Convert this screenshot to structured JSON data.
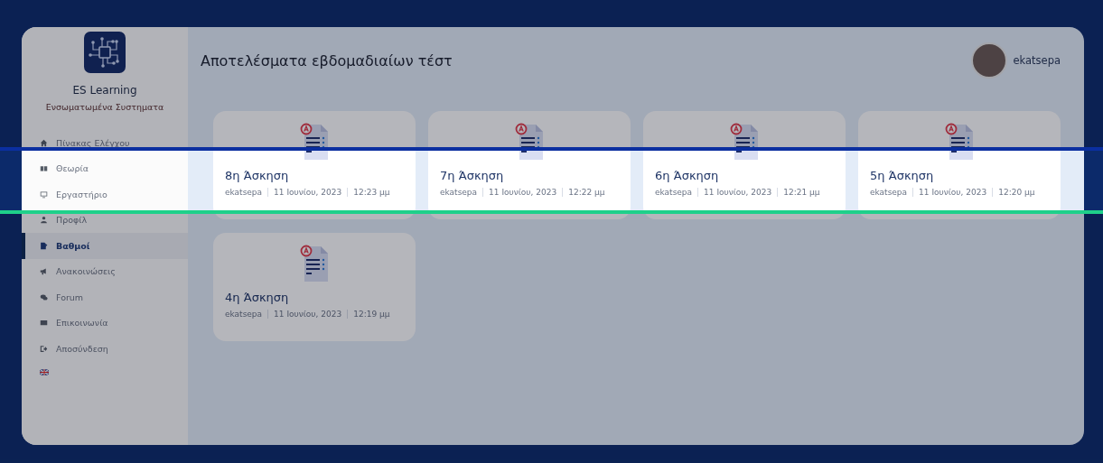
{
  "sidebar": {
    "brand": "ES Learning",
    "subtitle": "Ενσωματωμένα Συστηματα",
    "items": [
      {
        "label": "Πίνακας Ελέγχου",
        "selected": false
      },
      {
        "label": "Θεωρία",
        "selected": false
      },
      {
        "label": "Εργαστήριο",
        "selected": false
      },
      {
        "label": "Προφίλ",
        "selected": false
      },
      {
        "label": "Βαθμοί",
        "selected": true
      },
      {
        "label": "Ανακοινώσεις",
        "selected": false
      },
      {
        "label": "Forum",
        "selected": false
      },
      {
        "label": "Επικοινωνία",
        "selected": false
      },
      {
        "label": "Αποσύνδεση",
        "selected": false
      }
    ]
  },
  "header": {
    "title": "Αποτελέσματα εβδομαδιαίων τέστ",
    "user": "ekatsepa"
  },
  "cards": [
    {
      "title": "8η Άσκηση",
      "author": "ekatsepa",
      "date": "11 Ιουνίου, 2023",
      "time": "12:23 μμ"
    },
    {
      "title": "7η Άσκηση",
      "author": "ekatsepa",
      "date": "11 Ιουνίου, 2023",
      "time": "12:22 μμ"
    },
    {
      "title": "6η Άσκηση",
      "author": "ekatsepa",
      "date": "11 Ιουνίου, 2023",
      "time": "12:21 μμ"
    },
    {
      "title": "5η Άσκηση",
      "author": "ekatsepa",
      "date": "11 Ιουνίου, 2023",
      "time": "12:20 μμ"
    },
    {
      "title": "4η Άσκηση",
      "author": "ekatsepa",
      "date": "11 Ιουνίου, 2023",
      "time": "12:19 μμ"
    }
  ]
}
